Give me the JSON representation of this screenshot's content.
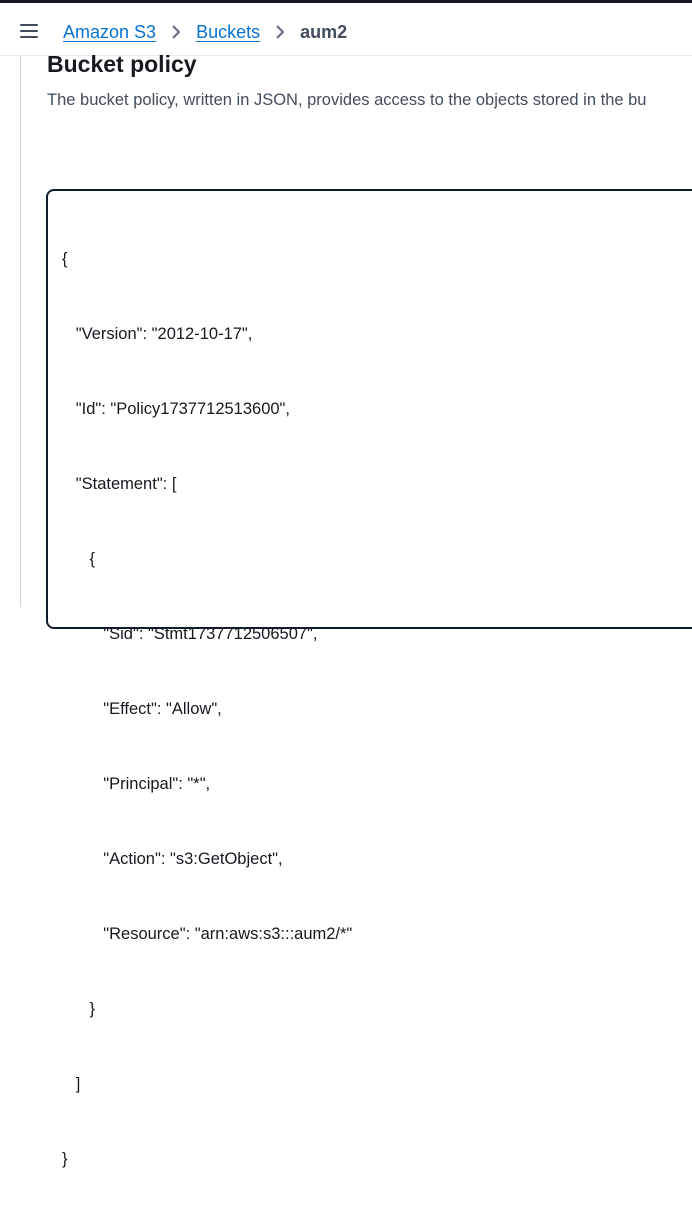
{
  "breadcrumb": {
    "items": [
      "Amazon S3",
      "Buckets"
    ],
    "current": "aum2"
  },
  "section": {
    "title": "Bucket policy",
    "description": "The bucket policy, written in JSON, provides access to the objects stored in the bu"
  },
  "policy_lines": [
    "{",
    "   \"Version\": \"2012-10-17\",",
    "   \"Id\": \"Policy1737712513600\",",
    "   \"Statement\": [",
    "      {",
    "         \"Sid\": \"Stmt1737712506507\",",
    "         \"Effect\": \"Allow\",",
    "         \"Principal\": \"*\",",
    "         \"Action\": \"s3:GetObject\",",
    "         \"Resource\": \"arn:aws:s3:::aum2/*\"",
    "      }",
    "   ]",
    "}"
  ],
  "icons": {
    "menu": "hamburger-menu-icon",
    "separator": "chevron-right-icon"
  },
  "colors": {
    "link": "#0972d3",
    "text": "#16191f",
    "muted": "#414d5c",
    "editor_border": "#0f1b2a"
  }
}
